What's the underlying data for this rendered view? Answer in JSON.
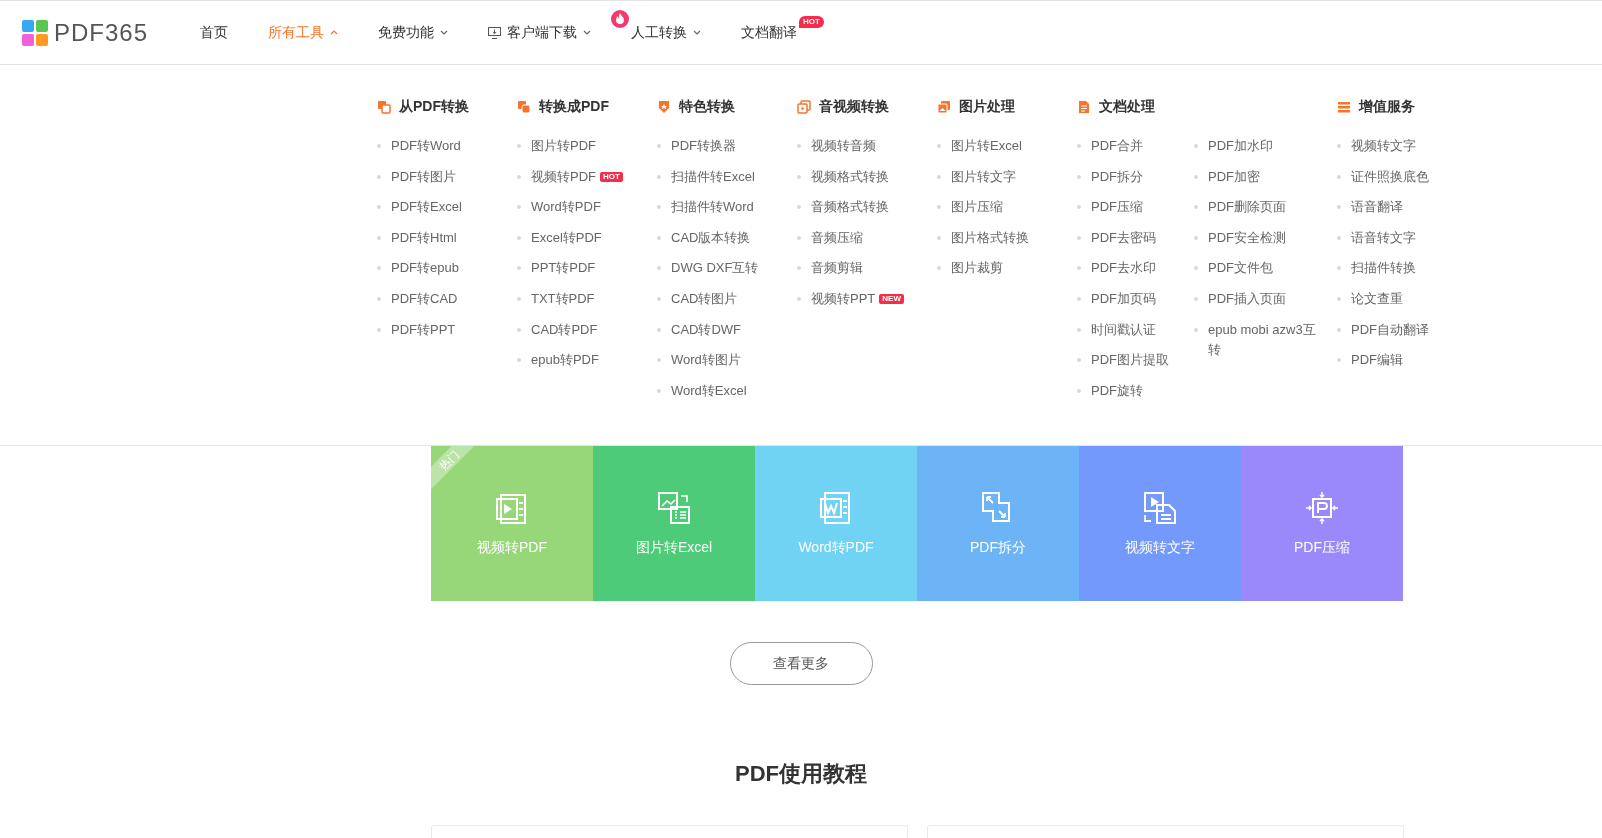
{
  "logo": {
    "text": "PDF365"
  },
  "nav": [
    {
      "label": "首页",
      "selected": false,
      "dropdown": false
    },
    {
      "label": "所有工具",
      "selected": true,
      "dropdown": true
    },
    {
      "label": "免费功能",
      "selected": false,
      "dropdown": true
    },
    {
      "label": "客户端下载",
      "selected": false,
      "dropdown": true,
      "kind": "download"
    },
    {
      "label": "人工转换",
      "selected": false,
      "dropdown": true,
      "kind": "hot"
    },
    {
      "label": "文档翻译",
      "selected": false,
      "dropdown": false,
      "badge": "HOT"
    }
  ],
  "menu": [
    {
      "title": "从PDF转换",
      "columns": [
        [
          {
            "label": "PDF转Word"
          },
          {
            "label": "PDF转图片"
          },
          {
            "label": "PDF转Excel"
          },
          {
            "label": "PDF转Html"
          },
          {
            "label": "PDF转epub"
          },
          {
            "label": "PDF转CAD"
          },
          {
            "label": "PDF转PPT"
          }
        ]
      ]
    },
    {
      "title": "转换成PDF",
      "columns": [
        [
          {
            "label": "图片转PDF"
          },
          {
            "label": "视频转PDF",
            "badge": "HOT"
          },
          {
            "label": "Word转PDF"
          },
          {
            "label": "Excel转PDF"
          },
          {
            "label": "PPT转PDF"
          },
          {
            "label": "TXT转PDF"
          },
          {
            "label": "CAD转PDF"
          },
          {
            "label": "epub转PDF"
          }
        ]
      ]
    },
    {
      "title": "特色转换",
      "columns": [
        [
          {
            "label": "PDF转换器"
          },
          {
            "label": "扫描件转Excel"
          },
          {
            "label": "扫描件转Word"
          },
          {
            "label": "CAD版本转换"
          },
          {
            "label": "DWG DXF互转"
          },
          {
            "label": "CAD转图片"
          },
          {
            "label": "CAD转DWF"
          },
          {
            "label": "Word转图片"
          },
          {
            "label": "Word转Excel"
          }
        ]
      ]
    },
    {
      "title": "音视频转换",
      "columns": [
        [
          {
            "label": "视频转音频"
          },
          {
            "label": "视频格式转换"
          },
          {
            "label": "音频格式转换"
          },
          {
            "label": "音频压缩"
          },
          {
            "label": "音频剪辑"
          },
          {
            "label": "视频转PPT",
            "badge": "NEW"
          }
        ]
      ]
    },
    {
      "title": "图片处理",
      "columns": [
        [
          {
            "label": "图片转Excel"
          },
          {
            "label": "图片转文字"
          },
          {
            "label": "图片压缩"
          },
          {
            "label": "图片格式转换"
          },
          {
            "label": "图片裁剪"
          }
        ]
      ]
    },
    {
      "title": "文档处理",
      "columns": [
        [
          {
            "label": "PDF合并"
          },
          {
            "label": "PDF拆分"
          },
          {
            "label": "PDF压缩"
          },
          {
            "label": "PDF去密码"
          },
          {
            "label": "PDF去水印"
          },
          {
            "label": "PDF加页码"
          },
          {
            "label": "时间戳认证"
          },
          {
            "label": "PDF图片提取"
          },
          {
            "label": "PDF旋转"
          }
        ],
        [
          {
            "label": "PDF加水印"
          },
          {
            "label": "PDF加密"
          },
          {
            "label": "PDF删除页面"
          },
          {
            "label": "PDF安全检测"
          },
          {
            "label": "PDF文件包"
          },
          {
            "label": "PDF插入页面"
          },
          {
            "label": "epub mobi azw3互转"
          }
        ]
      ]
    },
    {
      "title": "增值服务",
      "columns": [
        [
          {
            "label": "视频转文字"
          },
          {
            "label": "证件照换底色"
          },
          {
            "label": "语音翻译"
          },
          {
            "label": "语音转文字"
          },
          {
            "label": "扫描件转换"
          },
          {
            "label": "论文查重"
          },
          {
            "label": "PDF自动翻译"
          },
          {
            "label": "PDF编辑"
          }
        ]
      ]
    }
  ],
  "tiles": [
    {
      "label": "视频转PDF",
      "color": "#98d67a",
      "ribbon": "热门"
    },
    {
      "label": "图片转Excel",
      "color": "#4ecb78"
    },
    {
      "label": "Word转PDF",
      "color": "#70d3f3"
    },
    {
      "label": "PDF拆分",
      "color": "#6cb4f6"
    },
    {
      "label": "视频转文字",
      "color": "#7399fd"
    },
    {
      "label": "PDF压缩",
      "color": "#9a89fb"
    }
  ],
  "more_button": "查看更多",
  "section_title": "PDF使用教程"
}
